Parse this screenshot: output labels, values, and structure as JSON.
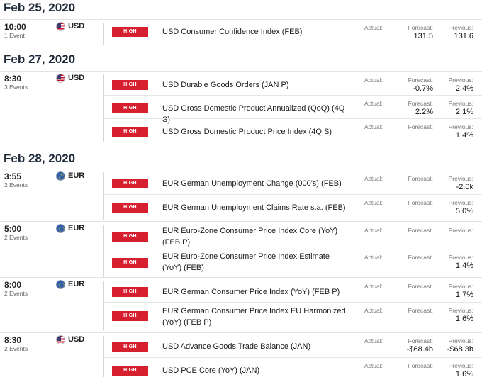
{
  "labels": {
    "actual": "Actual:",
    "forecast": "Forecast:",
    "previous": "Previous:",
    "impact": "HIGH"
  },
  "colors": {
    "impact_high": "#d6202f",
    "header_text": "#1e2a3a"
  },
  "days": [
    {
      "date": "Feb 25, 2020"
    },
    {
      "date": "Feb 27, 2020"
    },
    {
      "date": "Feb 28, 2020"
    }
  ],
  "groups": [
    {
      "time": "10:00",
      "count": "1 Event",
      "flag_icon": "us-flag-icon",
      "currency": "USD",
      "events": [
        {
          "name": "USD Consumer Confidence Index (FEB)",
          "actual": "",
          "forecast": "131.5",
          "previous": "131.6"
        }
      ]
    },
    {
      "time": "8:30",
      "count": "3 Events",
      "flag_icon": "us-flag-icon",
      "currency": "USD",
      "events": [
        {
          "name": "USD Durable Goods Orders (JAN P)",
          "actual": "",
          "forecast": "-0.7%",
          "previous": "2.4%"
        },
        {
          "name": "USD Gross Domestic Product Annualized (QoQ) (4Q S)",
          "actual": "",
          "forecast": "2.2%",
          "previous": "2.1%"
        },
        {
          "name": "USD Gross Domestic Product Price Index (4Q S)",
          "actual": "",
          "forecast": "",
          "previous": "1.4%"
        }
      ]
    },
    {
      "time": "3:55",
      "count": "2 Events",
      "flag_icon": "eu-flag-icon",
      "currency": "EUR",
      "events": [
        {
          "name": "EUR German Unemployment Change (000's) (FEB)",
          "actual": "",
          "forecast": "",
          "previous": "-2.0k"
        },
        {
          "name": "EUR German Unemployment Claims Rate s.a. (FEB)",
          "actual": "",
          "forecast": "",
          "previous": "5.0%"
        }
      ]
    },
    {
      "time": "5:00",
      "count": "2 Events",
      "flag_icon": "eu-flag-icon",
      "currency": "EUR",
      "events": [
        {
          "name": "EUR Euro-Zone Consumer Price Index Core (YoY) (FEB P)",
          "actual": "",
          "forecast": "",
          "previous": ""
        },
        {
          "name": "EUR Euro-Zone Consumer Price Index Estimate (YoY) (FEB)",
          "actual": "",
          "forecast": "",
          "previous": "1.4%"
        }
      ]
    },
    {
      "time": "8:00",
      "count": "2 Events",
      "flag_icon": "eu-flag-icon",
      "currency": "EUR",
      "events": [
        {
          "name": "EUR German Consumer Price Index (YoY) (FEB P)",
          "actual": "",
          "forecast": "",
          "previous": "1.7%"
        },
        {
          "name": "EUR German Consumer Price Index EU Harmonized (YoY) (FEB P)",
          "actual": "",
          "forecast": "",
          "previous": "1.6%"
        }
      ]
    },
    {
      "time": "8:30",
      "count": "2 Events",
      "flag_icon": "us-flag-icon",
      "currency": "USD",
      "events": [
        {
          "name": "USD Advance Goods Trade Balance (JAN)",
          "actual": "",
          "forecast": "-$68.4b",
          "previous": "-$68.3b"
        },
        {
          "name": "USD PCE Core (YoY) (JAN)",
          "actual": "",
          "forecast": "",
          "previous": "1.6%"
        }
      ]
    }
  ]
}
